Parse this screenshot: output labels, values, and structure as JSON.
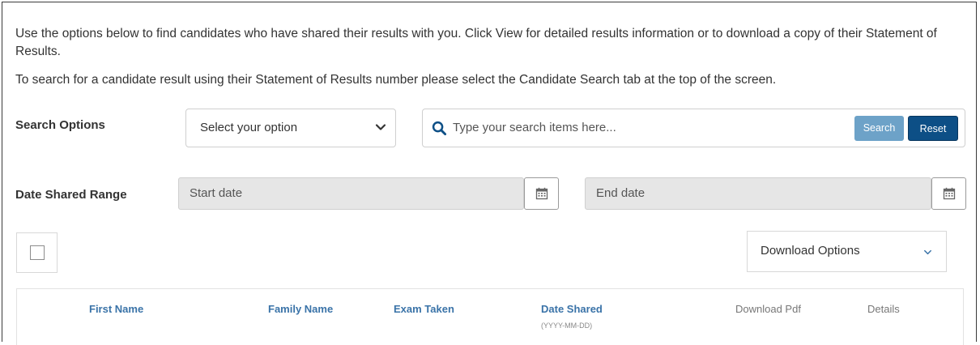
{
  "intro": {
    "paragraph1": "Use the options below to find candidates who have shared their results with you. Click View for detailed results information or to download a copy of their Statement of Results.",
    "paragraph2": "To search for a candidate result using their Statement of Results number please select the Candidate Search tab at the top of the screen."
  },
  "search_options": {
    "label": "Search Options",
    "select_value": "Select your option",
    "search_placeholder": "Type your search items here...",
    "search_button": "Search",
    "reset_button": "Reset"
  },
  "date_range": {
    "label": "Date Shared Range",
    "start_placeholder": "Start date",
    "end_placeholder": "End date"
  },
  "download_options": {
    "label": "Download Options"
  },
  "table": {
    "headers": {
      "first_name": "First Name",
      "family_name": "Family Name",
      "exam_taken": "Exam Taken",
      "date_shared": "Date Shared",
      "date_shared_format": "(YYYY-MM-DD)",
      "download_pdf": "Download Pdf",
      "details": "Details"
    }
  },
  "colors": {
    "search_button": "#6da2c8",
    "reset_button": "#0d4f86",
    "header_link": "#3a73a8",
    "disabled_field": "#e6e6e6"
  },
  "icons": [
    "chevron-down-icon",
    "search-icon",
    "calendar-icon"
  ]
}
